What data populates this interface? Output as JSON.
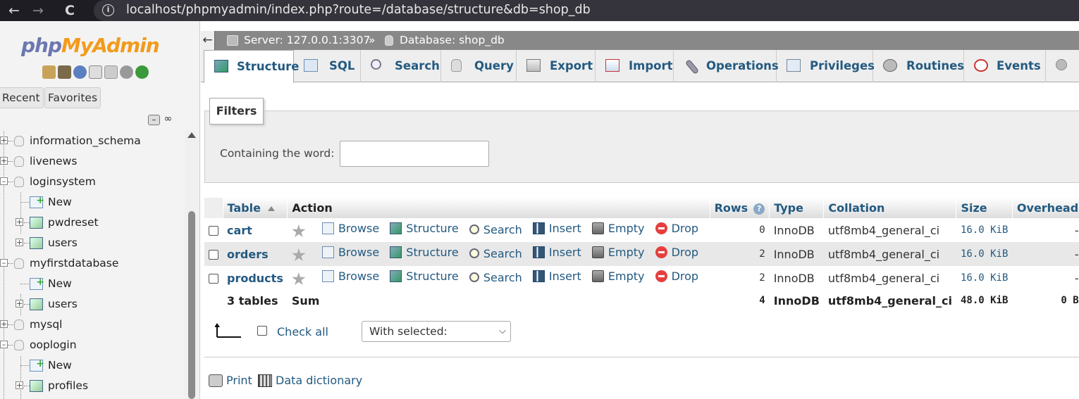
{
  "browser": {
    "url": "localhost/phpmyadmin/index.php?route=/database/structure&db=shop_db",
    "back_glyph": "←",
    "forward_glyph": "→",
    "reload_glyph": "C"
  },
  "nav": {
    "logo_php": "php",
    "logo_myadmin": "MyAdmin",
    "tab_recent": "Recent",
    "tab_favorites": "Favorites",
    "tree": [
      {
        "label": "information_schema",
        "kind": "db"
      },
      {
        "label": "livenews",
        "kind": "db"
      },
      {
        "label": "loginsystem",
        "kind": "db"
      },
      {
        "label": "New",
        "kind": "new"
      },
      {
        "label": "pwdreset",
        "kind": "table"
      },
      {
        "label": "users",
        "kind": "table"
      },
      {
        "label": "myfirstdatabase",
        "kind": "db"
      },
      {
        "label": "New",
        "kind": "new"
      },
      {
        "label": "users",
        "kind": "table"
      },
      {
        "label": "mysql",
        "kind": "db"
      },
      {
        "label": "ooplogin",
        "kind": "db"
      },
      {
        "label": "New",
        "kind": "new"
      },
      {
        "label": "profiles",
        "kind": "table"
      }
    ]
  },
  "breadcrumb": {
    "server": "Server: 127.0.0.1:3307",
    "separator": "»",
    "database": "Database: shop_db"
  },
  "tabs": {
    "structure": "Structure",
    "sql": "SQL",
    "search": "Search",
    "query": "Query",
    "export": "Export",
    "import": "Import",
    "operations": "Operations",
    "privileges": "Privileges",
    "routines": "Routines",
    "events": "Events"
  },
  "filters": {
    "legend": "Filters",
    "label": "Containing the word:",
    "value": ""
  },
  "table": {
    "headers": {
      "table": "Table",
      "action": "Action",
      "rows": "Rows",
      "type": "Type",
      "collation": "Collation",
      "size": "Size",
      "overhead": "Overhead"
    },
    "actions": {
      "browse": "Browse",
      "structure": "Structure",
      "search": "Search",
      "insert": "Insert",
      "empty": "Empty",
      "drop": "Drop"
    },
    "rows": [
      {
        "name": "cart",
        "rows": "0",
        "type": "InnoDB",
        "collation": "utf8mb4_general_ci",
        "size": "16.0 KiB",
        "overhead": "-"
      },
      {
        "name": "orders",
        "rows": "2",
        "type": "InnoDB",
        "collation": "utf8mb4_general_ci",
        "size": "16.0 KiB",
        "overhead": "-"
      },
      {
        "name": "products",
        "rows": "2",
        "type": "InnoDB",
        "collation": "utf8mb4_general_ci",
        "size": "16.0 KiB",
        "overhead": "-"
      }
    ],
    "footer": {
      "count": "3 tables",
      "sum": "Sum",
      "rows": "4",
      "type": "InnoDB",
      "collation": "utf8mb4_general_ci",
      "size": "48.0 KiB",
      "overhead": "0 B"
    }
  },
  "bulk": {
    "check_all": "Check all",
    "with_selected": "With selected:"
  },
  "links": {
    "print": "Print",
    "data_dictionary": "Data dictionary"
  }
}
